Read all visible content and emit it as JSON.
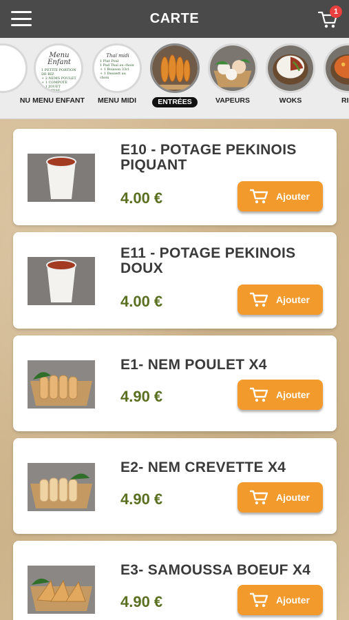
{
  "header": {
    "title": "CARTE",
    "cart_count": "1"
  },
  "categories": [
    {
      "label": "NU",
      "icon": "menu-card-icon"
    },
    {
      "label": "MENU ENFANT",
      "icon": "menu-enfant-card-icon"
    },
    {
      "label": "MENU MIDI",
      "icon": "menu-midi-card-icon"
    },
    {
      "label": "ENTRÉES",
      "icon": "entrees-food-icon",
      "active": true
    },
    {
      "label": "VAPEURS",
      "icon": "dumplings-icon"
    },
    {
      "label": "WOKS",
      "icon": "wok-bowl-icon"
    },
    {
      "label": "RI",
      "icon": "rice-icon"
    }
  ],
  "menu_enfant_card": {
    "title": "Menu Enfant"
  },
  "menu_midi_card": {
    "title": "Thaï midi",
    "lines": [
      "1 Plat Poul",
      "1 Pad Thaï au choix",
      "+ 1 Boisson 33cl",
      "+ 1 Dessert au choix"
    ]
  },
  "products": [
    {
      "name": "E10 - POTAGE PEKINOIS PIQUANT",
      "price": "4.00 €",
      "button": "Ajouter",
      "image": "soup-cup-image"
    },
    {
      "name": "E11 - POTAGE PEKINOIS DOUX",
      "price": "4.00 €",
      "button": "Ajouter",
      "image": "soup-cup-image"
    },
    {
      "name": "E1- NEM POULET X4",
      "price": "4.90 €",
      "button": "Ajouter",
      "image": "nem-tray-image"
    },
    {
      "name": "E2- NEM CREVETTE X4",
      "price": "4.90 €",
      "button": "Ajouter",
      "image": "nem-tray-image"
    },
    {
      "name": "E3- SAMOUSSA BOEUF X4",
      "price": "4.90 €",
      "button": "Ajouter",
      "image": "samoussa-tray-image"
    }
  ],
  "colors": {
    "header_bg": "#4a4a4a",
    "button_orange": "#f39a2c",
    "price_green": "#5a6f1f",
    "badge_red": "#e8403f"
  }
}
